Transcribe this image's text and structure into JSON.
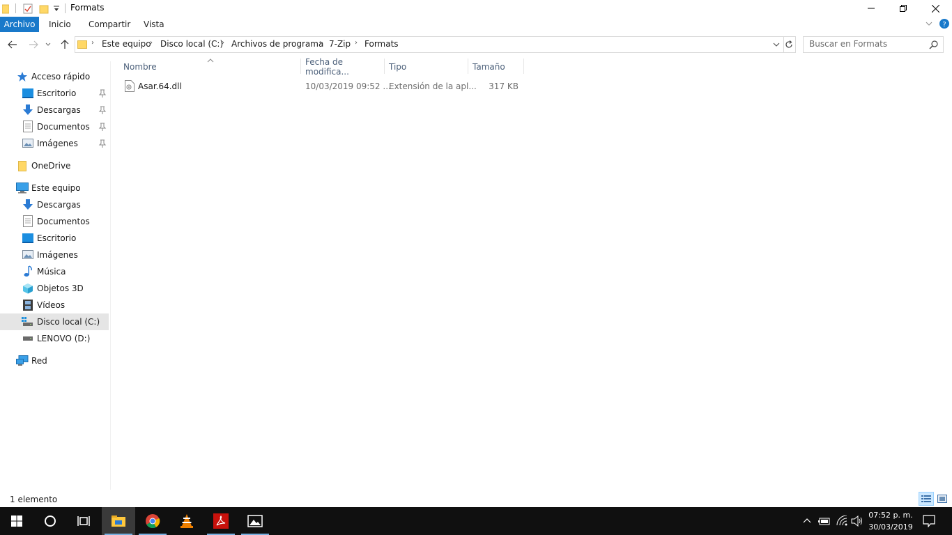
{
  "window": {
    "title": "Formats"
  },
  "ribbon": {
    "tabs": [
      "Archivo",
      "Inicio",
      "Compartir",
      "Vista"
    ]
  },
  "address": {
    "crumbs": [
      "Este equipo",
      "Disco local (C:)",
      "Archivos de programa",
      "7-Zip",
      "Formats"
    ]
  },
  "search": {
    "placeholder": "Buscar en Formats"
  },
  "sidebar": {
    "quick_access": "Acceso rápido",
    "quick_items": [
      "Escritorio",
      "Descargas",
      "Documentos",
      "Imágenes"
    ],
    "onedrive": "OneDrive",
    "this_pc": "Este equipo",
    "pc_items": [
      "Descargas",
      "Documentos",
      "Escritorio",
      "Imágenes",
      "Música",
      "Objetos 3D",
      "Vídeos",
      "Disco local (C:)",
      "LENOVO (D:)"
    ],
    "network": "Red"
  },
  "columns": [
    "Nombre",
    "Fecha de modifica...",
    "Tipo",
    "Tamaño"
  ],
  "files": [
    {
      "name": "Asar.64.dll",
      "date": "10/03/2019 09:52 ...",
      "type": "Extensión de la apl...",
      "size": "317 KB"
    }
  ],
  "status": {
    "count": "1 elemento"
  },
  "taskbar": {
    "time": "07:52 p. m.",
    "date": "30/03/2019"
  },
  "colors": {
    "accent": "#1979ca",
    "folder": "#ffd867",
    "selected": "#e5e5e5"
  }
}
